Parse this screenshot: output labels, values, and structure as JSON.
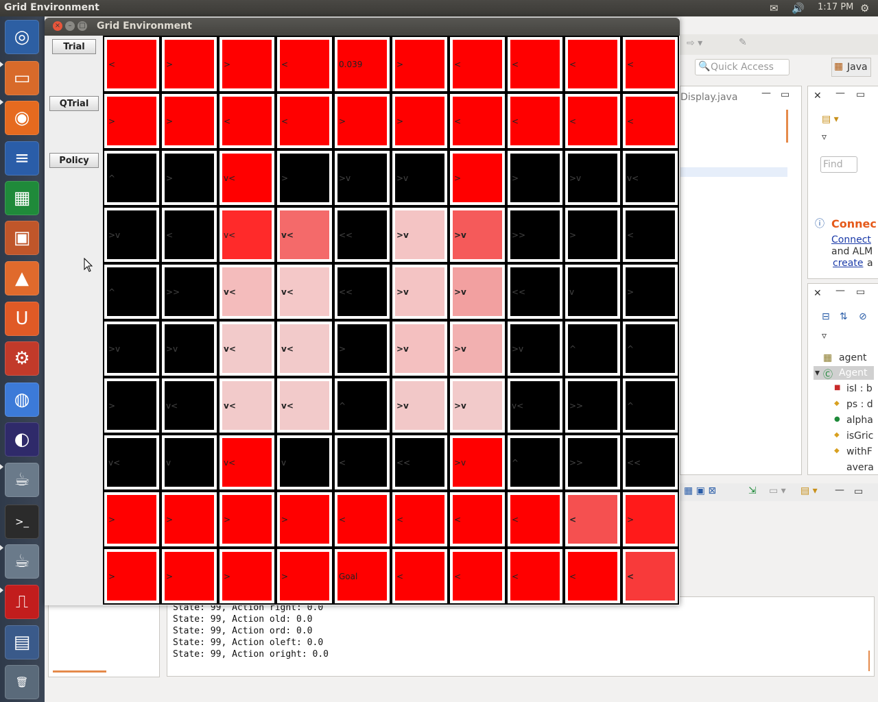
{
  "top_panel": {
    "app_title": "Grid Environment",
    "time": "1:17 PM"
  },
  "launcher": {
    "items": [
      {
        "name": "ubuntu-dash-icon",
        "color": "#2d5fa3",
        "glyph": "◎"
      },
      {
        "name": "files-icon",
        "color": "#d86a2a",
        "glyph": "▭"
      },
      {
        "name": "firefox-icon",
        "color": "#e66a1f",
        "glyph": "◉"
      },
      {
        "name": "writer-icon",
        "color": "#2a5da8",
        "glyph": "≡"
      },
      {
        "name": "calc-icon",
        "color": "#1f8a3a",
        "glyph": "▦"
      },
      {
        "name": "impress-icon",
        "color": "#c0562a",
        "glyph": "▣"
      },
      {
        "name": "software-center-icon",
        "color": "#e06a2c",
        "glyph": "▲"
      },
      {
        "name": "ubuntu-one-icon",
        "color": "#e05a26",
        "glyph": "U"
      },
      {
        "name": "system-settings-icon",
        "color": "#c23a2a",
        "glyph": "⚙"
      },
      {
        "name": "chrome-icon",
        "color": "#3c7ad8",
        "glyph": "◍"
      },
      {
        "name": "eclipse-icon",
        "color": "#2f2a6a",
        "glyph": "◐"
      },
      {
        "name": "java-icon",
        "color": "#6a7a8a",
        "glyph": "☕"
      },
      {
        "name": "terminal-icon",
        "color": "#2b2b2b",
        "glyph": ">_"
      },
      {
        "name": "java-app-icon",
        "color": "#6a7a8a",
        "glyph": "☕"
      },
      {
        "name": "pdf-reader-icon",
        "color": "#c21d1d",
        "glyph": "⎍"
      },
      {
        "name": "workspace-switcher-icon",
        "color": "#3a5a8a",
        "glyph": "▤"
      },
      {
        "name": "trash-icon",
        "color": "#5a6a7a",
        "glyph": "🗑"
      }
    ]
  },
  "window": {
    "title": "Grid Environment",
    "buttons": {
      "trial": "Trial",
      "qtrial": "QTrial",
      "policy": "Policy"
    }
  },
  "grid": {
    "rows": [
      [
        {
          "c": "#ff0000",
          "t": "<"
        },
        {
          "c": "#ff0000",
          "t": ">"
        },
        {
          "c": "#ff0000",
          "t": ">"
        },
        {
          "c": "#ff0000",
          "t": "<"
        },
        {
          "c": "#ff0000",
          "t": "0.039"
        },
        {
          "c": "#ff0000",
          "t": ">"
        },
        {
          "c": "#ff0000",
          "t": "<"
        },
        {
          "c": "#ff0000",
          "t": "<"
        },
        {
          "c": "#ff0000",
          "t": "<"
        },
        {
          "c": "#ff0000",
          "t": "<"
        }
      ],
      [
        {
          "c": "#ff0000",
          "t": ">"
        },
        {
          "c": "#ff0000",
          "t": ">"
        },
        {
          "c": "#ff0000",
          "t": "<"
        },
        {
          "c": "#ff0000",
          "t": "<"
        },
        {
          "c": "#ff0000",
          "t": ">"
        },
        {
          "c": "#ff0000",
          "t": ">"
        },
        {
          "c": "#ff0000",
          "t": "<"
        },
        {
          "c": "#ff0000",
          "t": "<"
        },
        {
          "c": "#ff0000",
          "t": "<"
        },
        {
          "c": "#ff0000",
          "t": "<"
        }
      ],
      [
        {
          "c": "#000000",
          "t": "^"
        },
        {
          "c": "#000000",
          "t": ">"
        },
        {
          "c": "#ff0000",
          "t": "v<"
        },
        {
          "c": "#000000",
          "t": ">"
        },
        {
          "c": "#000000",
          "t": ">v"
        },
        {
          "c": "#000000",
          "t": ">v"
        },
        {
          "c": "#ff0000",
          "t": ">"
        },
        {
          "c": "#000000",
          "t": ">"
        },
        {
          "c": "#000000",
          "t": ">v"
        },
        {
          "c": "#000000",
          "t": "v<"
        }
      ],
      [
        {
          "c": "#000000",
          "t": ">v"
        },
        {
          "c": "#000000",
          "t": "<"
        },
        {
          "c": "#ff2a2a",
          "t": "v<"
        },
        {
          "c": "#f46a6a",
          "t": "v<"
        },
        {
          "c": "#000000",
          "t": "<<"
        },
        {
          "c": "#f4c4c4",
          "t": ">v"
        },
        {
          "c": "#f55a5a",
          "t": ">v"
        },
        {
          "c": "#000000",
          "t": ">>"
        },
        {
          "c": "#000000",
          "t": ">"
        },
        {
          "c": "#000000",
          "t": "<"
        }
      ],
      [
        {
          "c": "#000000",
          "t": "^"
        },
        {
          "c": "#000000",
          "t": ">>"
        },
        {
          "c": "#f4bcbc",
          "t": "v<"
        },
        {
          "c": "#f4c8c8",
          "t": "v<"
        },
        {
          "c": "#000000",
          "t": "<<"
        },
        {
          "c": "#f4c4c4",
          "t": ">v"
        },
        {
          "c": "#f2a0a0",
          "t": ">v"
        },
        {
          "c": "#000000",
          "t": "<<"
        },
        {
          "c": "#000000",
          "t": "v"
        },
        {
          "c": "#000000",
          "t": ">"
        }
      ],
      [
        {
          "c": "#000000",
          "t": ">v"
        },
        {
          "c": "#000000",
          "t": ">v"
        },
        {
          "c": "#f2caca",
          "t": "v<"
        },
        {
          "c": "#f2caca",
          "t": "v<"
        },
        {
          "c": "#000000",
          "t": ">"
        },
        {
          "c": "#f4c0c0",
          "t": ">v"
        },
        {
          "c": "#f2b0b0",
          "t": ">v"
        },
        {
          "c": "#000000",
          "t": ">v"
        },
        {
          "c": "#000000",
          "t": "^"
        },
        {
          "c": "#000000",
          "t": "^"
        }
      ],
      [
        {
          "c": "#000000",
          "t": ">"
        },
        {
          "c": "#000000",
          "t": "v<"
        },
        {
          "c": "#f2caca",
          "t": "v<"
        },
        {
          "c": "#f2caca",
          "t": "v<"
        },
        {
          "c": "#000000",
          "t": "^"
        },
        {
          "c": "#f2c8c8",
          "t": ">v"
        },
        {
          "c": "#f2caca",
          "t": ">v"
        },
        {
          "c": "#000000",
          "t": "v<"
        },
        {
          "c": "#000000",
          "t": ">>"
        },
        {
          "c": "#000000",
          "t": "^"
        }
      ],
      [
        {
          "c": "#000000",
          "t": "v<"
        },
        {
          "c": "#000000",
          "t": "v"
        },
        {
          "c": "#ff0000",
          "t": "v<"
        },
        {
          "c": "#000000",
          "t": "v"
        },
        {
          "c": "#000000",
          "t": "<"
        },
        {
          "c": "#000000",
          "t": "<<"
        },
        {
          "c": "#ff0000",
          "t": ">v"
        },
        {
          "c": "#000000",
          "t": "^"
        },
        {
          "c": "#000000",
          "t": ">>"
        },
        {
          "c": "#000000",
          "t": "<<"
        }
      ],
      [
        {
          "c": "#ff0000",
          "t": ">"
        },
        {
          "c": "#ff0000",
          "t": ">"
        },
        {
          "c": "#ff0000",
          "t": ">"
        },
        {
          "c": "#ff0000",
          "t": ">"
        },
        {
          "c": "#ff0000",
          "t": "<"
        },
        {
          "c": "#ff0000",
          "t": "<"
        },
        {
          "c": "#ff0000",
          "t": "<"
        },
        {
          "c": "#ff0000",
          "t": "<"
        },
        {
          "c": "#f55050",
          "t": "<"
        },
        {
          "c": "#ff1a1a",
          "t": ">"
        }
      ],
      [
        {
          "c": "#ff0000",
          "t": ">"
        },
        {
          "c": "#ff0000",
          "t": ">"
        },
        {
          "c": "#ff0000",
          "t": ">"
        },
        {
          "c": "#ff0000",
          "t": ">"
        },
        {
          "c": "#ff0000",
          "t": "Goal"
        },
        {
          "c": "#ff0000",
          "t": "<"
        },
        {
          "c": "#ff0000",
          "t": "<"
        },
        {
          "c": "#ff0000",
          "t": "<"
        },
        {
          "c": "#ff0000",
          "t": "<"
        },
        {
          "c": "#f83a3a",
          "t": "<"
        }
      ]
    ]
  },
  "eclipse": {
    "quick_access_placeholder": "Quick Access",
    "perspective": "Java",
    "editor_tab": "Display.java",
    "find_placeholder": "Find",
    "mylyn": {
      "title": "Connec",
      "link1": "Connect",
      "text2": "and ALM",
      "link3": "create",
      "text4": "a"
    },
    "outline_items": [
      "agent",
      "Agent",
      "isI : b",
      "ps : d",
      "alpha",
      "isGric",
      "withF",
      "avera"
    ]
  },
  "console": {
    "lines": [
      "State: 99, Action right: 0.0",
      "State: 99, Action old: 0.0",
      "State: 99, Action ord: 0.0",
      "State: 99, Action oleft: 0.0",
      "State: 99, Action oright: 0.0"
    ]
  }
}
